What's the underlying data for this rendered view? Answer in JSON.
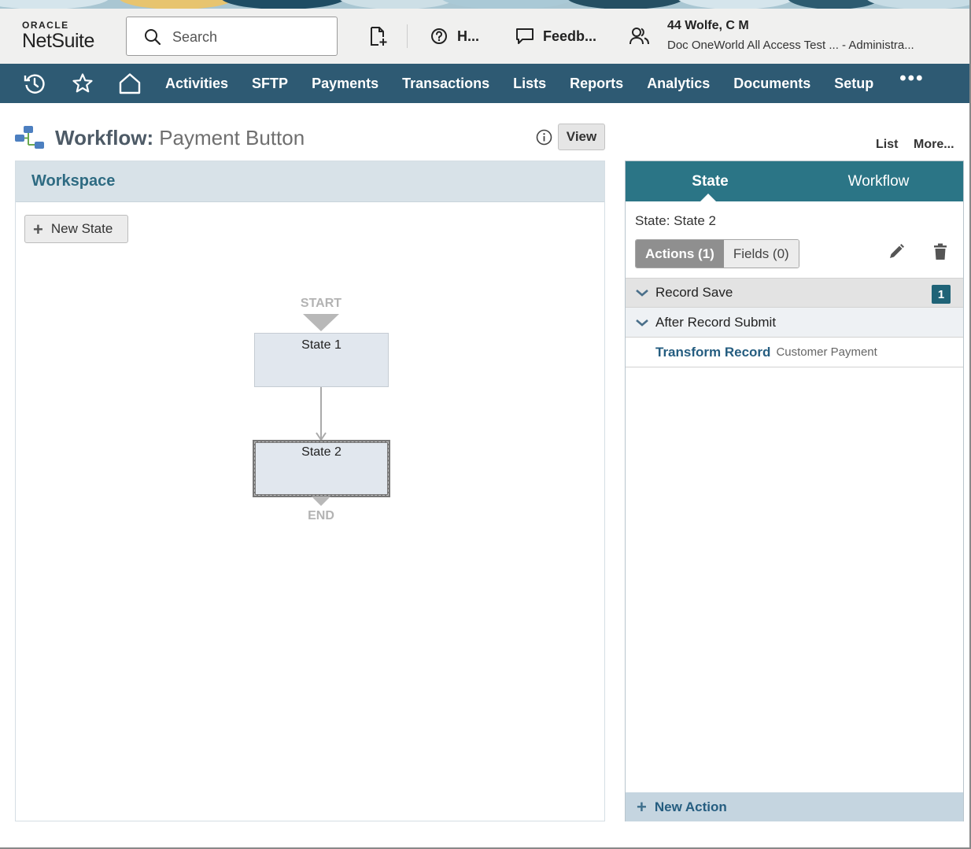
{
  "header": {
    "logo_top": "ORACLE",
    "logo_main": "NetSuite",
    "search_placeholder": "Search",
    "help_label": "H...",
    "feedback_label": "Feedb...",
    "user_name": "44 Wolfe, C M",
    "user_role": "Doc OneWorld All Access Test ...   - Administra..."
  },
  "nav": {
    "items": [
      "Activities",
      "SFTP",
      "Payments",
      "Transactions",
      "Lists",
      "Reports",
      "Analytics",
      "Documents",
      "Setup"
    ],
    "more": "•••"
  },
  "page": {
    "title_label": "Workflow:",
    "title_value": "Payment Button",
    "view_button": "View",
    "list_link": "List",
    "more_link": "More..."
  },
  "workspace": {
    "header": "Workspace",
    "new_state_button": "New State",
    "start_label": "START",
    "end_label": "END",
    "states": [
      "State 1",
      "State 2"
    ]
  },
  "right_panel": {
    "tabs": [
      "State",
      "Workflow"
    ],
    "state_line": "State: State 2",
    "actions_tab": "Actions (1)",
    "fields_tab": "Fields (0)",
    "triggers": [
      {
        "label": "Record Save",
        "badge": "1"
      },
      {
        "label": "After Record Submit"
      }
    ],
    "action": {
      "name": "Transform Record",
      "description": "Customer Payment"
    },
    "new_action": "New Action"
  },
  "colors": {
    "nav_bg": "#2e5a73",
    "tab_bg": "#2b7586",
    "link": "#255d80"
  }
}
